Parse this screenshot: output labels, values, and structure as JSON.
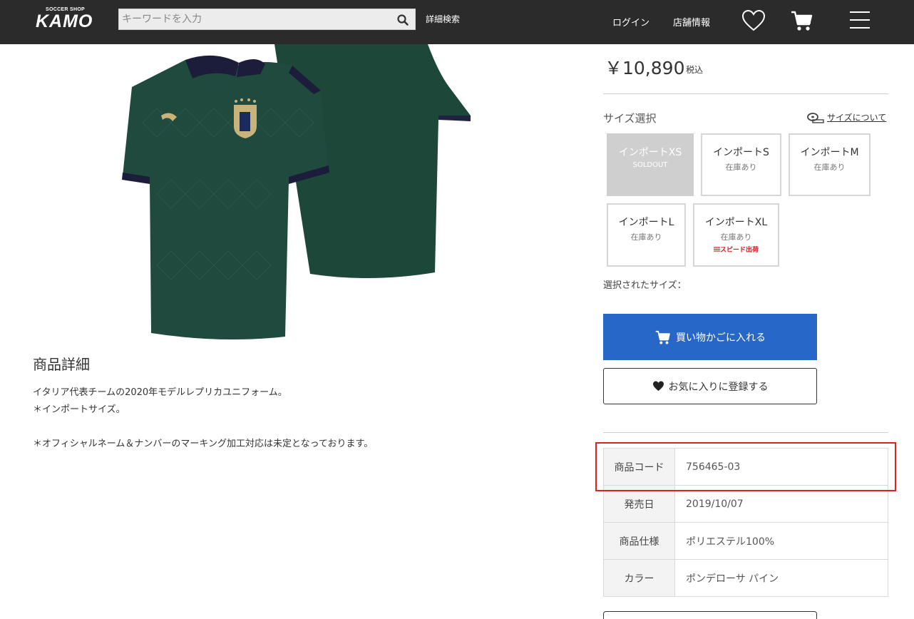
{
  "header": {
    "logo_sub": "SOCCER SHOP",
    "logo_main": "KAMO",
    "search_placeholder": "キーワードを入力",
    "advanced_search": "詳細検索",
    "login": "ログイン",
    "store_info": "店舗情報",
    "icons": [
      "search-icon",
      "heart-icon",
      "cart-icon",
      "menu-icon"
    ]
  },
  "product": {
    "price": "￥10,890",
    "tax_label": "税込",
    "size_label": "サイズ選択",
    "size_guide": "サイズについて",
    "sizes": [
      {
        "name": "インポートXS",
        "status": "SOLDOUT",
        "soldout": true
      },
      {
        "name": "インポートS",
        "status": "在庫あり"
      },
      {
        "name": "インポートM",
        "status": "在庫あり"
      },
      {
        "name": "インポートL",
        "status": "在庫あり"
      },
      {
        "name": "インポートXL",
        "status": "在庫あり",
        "badge": "スピード出荷"
      }
    ],
    "selected_size_label": "選択されたサイズ："
  },
  "actions": {
    "add_to_cart": "買い物かごに入れる",
    "add_to_favorites": "お気に入りに登録する"
  },
  "details": {
    "title": "商品詳細",
    "lines": [
      "イタリア代表チームの2020年モデルレプリカユニフォーム。",
      "＊インポートサイズ。",
      "＊オフィシャルネーム＆ナンバーのマーキング加工対応は未定となっております。"
    ]
  },
  "specs": [
    {
      "label": "商品コード",
      "value": "756465-03"
    },
    {
      "label": "発売日",
      "value": "2019/10/07"
    },
    {
      "label": "商品仕様",
      "value": "ポリエステル100%"
    },
    {
      "label": "カラー",
      "value": "ポンデローサ パイン"
    }
  ],
  "colors": {
    "header_bg": "#2b2b2b",
    "cart_button": "#2767c8",
    "soldout_bg": "#cfcfcf",
    "speed_badge": "#d4161d",
    "highlight": "#e02020",
    "jersey": "#1f4a3d"
  }
}
